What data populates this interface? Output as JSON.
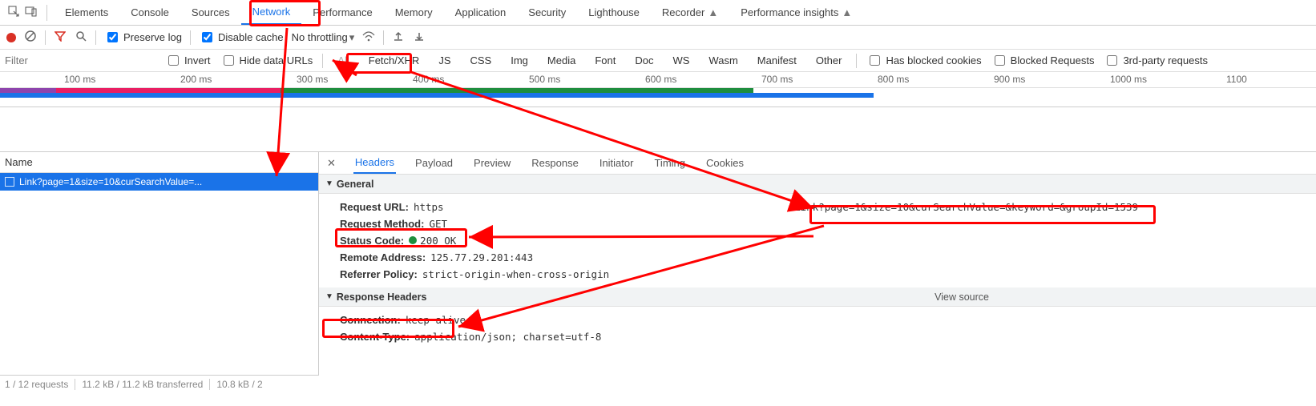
{
  "main_tabs": {
    "items": [
      {
        "label": "Elements"
      },
      {
        "label": "Console"
      },
      {
        "label": "Sources"
      },
      {
        "label": "Network",
        "active": true
      },
      {
        "label": "Performance"
      },
      {
        "label": "Memory"
      },
      {
        "label": "Application"
      },
      {
        "label": "Security"
      },
      {
        "label": "Lighthouse"
      },
      {
        "label": "Recorder",
        "beta": true
      },
      {
        "label": "Performance insights",
        "beta": true
      }
    ]
  },
  "toolbar": {
    "preserve_log": "Preserve log",
    "disable_cache": "Disable cache",
    "throttling": "No throttling"
  },
  "filters": {
    "placeholder": "Filter",
    "invert": "Invert",
    "hide_data_urls": "Hide data URLs",
    "types": [
      "All",
      "Fetch/XHR",
      "JS",
      "CSS",
      "Img",
      "Media",
      "Font",
      "Doc",
      "WS",
      "Wasm",
      "Manifest",
      "Other"
    ],
    "selected_type": "Fetch/XHR",
    "has_blocked_cookies": "Has blocked cookies",
    "blocked_requests": "Blocked Requests",
    "third_party": "3rd-party requests"
  },
  "ruler": {
    "ticks": [
      "100 ms",
      "200 ms",
      "300 ms",
      "400 ms",
      "500 ms",
      "600 ms",
      "700 ms",
      "800 ms",
      "900 ms",
      "1000 ms",
      "1100"
    ]
  },
  "requests": {
    "header": "Name",
    "items": [
      {
        "name": "Link?page=1&size=10&curSearchValue=..."
      }
    ]
  },
  "details": {
    "tabs": [
      "Headers",
      "Payload",
      "Preview",
      "Response",
      "Initiator",
      "Timing",
      "Cookies"
    ],
    "active_tab": "Headers",
    "general": {
      "title": "General",
      "request_url_label": "Request URL:",
      "request_url_proto": "https",
      "request_url_tail": ":Link?page=1&size=10&curSearchValue=&keyword=&groupId=1539",
      "method_label": "Request Method:",
      "method_value": "GET",
      "status_label": "Status Code:",
      "status_value": "200 OK",
      "remote_label": "Remote Address:",
      "remote_value": "125.77.29.201:443",
      "referrer_label": "Referrer Policy:",
      "referrer_value": "strict-origin-when-cross-origin"
    },
    "response_headers": {
      "title": "Response Headers",
      "view_source": "View source",
      "connection_label": "Connection:",
      "connection_value": "keep-alive",
      "content_type_label": "Content-Type:",
      "content_type_value": "application/json; charset=utf-8"
    }
  },
  "status_bar": {
    "requests": "1 / 12 requests",
    "transferred": "11.2 kB / 11.2 kB transferred",
    "resources": "10.8 kB / 2"
  }
}
